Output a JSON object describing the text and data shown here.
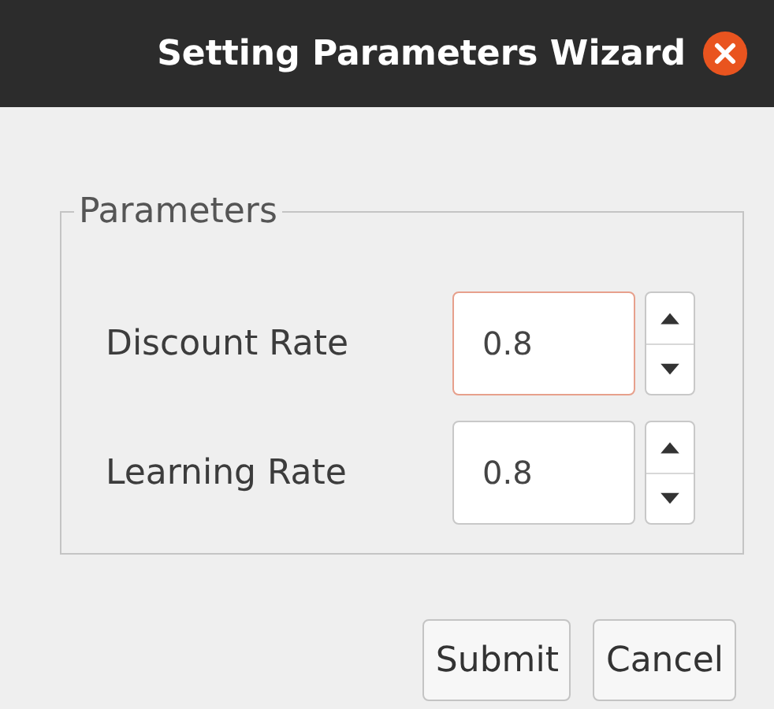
{
  "window": {
    "title": "Setting Parameters Wizard"
  },
  "group": {
    "title": "Parameters"
  },
  "fields": [
    {
      "label": "Discount Rate",
      "value": "0.8",
      "focused": true
    },
    {
      "label": "Learning Rate",
      "value": "0.8",
      "focused": false
    }
  ],
  "buttons": [
    "Submit",
    "Cancel"
  ]
}
